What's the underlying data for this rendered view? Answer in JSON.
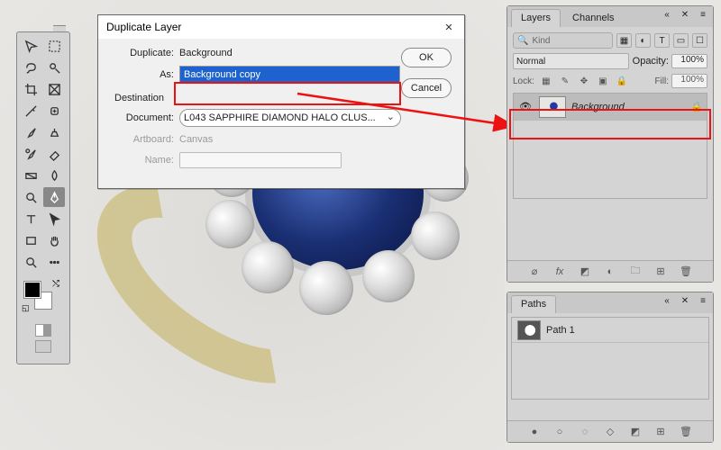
{
  "tools": [
    {
      "name": "move-tool"
    },
    {
      "name": "artboard-tool"
    },
    {
      "name": "marquee-tool"
    },
    {
      "name": "lasso-tool"
    },
    {
      "name": "crop-tool"
    },
    {
      "name": "frame-tool"
    },
    {
      "name": "eyedropper-tool"
    },
    {
      "name": "spot-heal-tool"
    },
    {
      "name": "brush-tool"
    },
    {
      "name": "clone-stamp-tool"
    },
    {
      "name": "history-brush-tool"
    },
    {
      "name": "eraser-tool"
    },
    {
      "name": "gradient-tool"
    },
    {
      "name": "blur-tool"
    },
    {
      "name": "dodge-tool"
    },
    {
      "name": "pen-tool",
      "selected": true
    },
    {
      "name": "type-tool"
    },
    {
      "name": "path-select-tool"
    },
    {
      "name": "rectangle-tool"
    },
    {
      "name": "hand-tool"
    },
    {
      "name": "zoom-tool"
    },
    {
      "name": "edit-toolbar"
    }
  ],
  "dialog": {
    "title": "Duplicate Layer",
    "duplicate_label": "Duplicate:",
    "duplicate_value": "Background",
    "as_label": "As:",
    "as_value": "Background copy",
    "destination_label": "Destination",
    "document_label": "Document:",
    "document_value": "L043 SAPPHIRE DIAMOND HALO CLUS...",
    "artboard_label": "Artboard:",
    "artboard_value": "Canvas",
    "name_label": "Name:",
    "ok_label": "OK",
    "cancel_label": "Cancel"
  },
  "layers_panel": {
    "tab_layers": "Layers",
    "tab_channels": "Channels",
    "kind_placeholder": "Kind",
    "blend_mode": "Normal",
    "opacity_label": "Opacity:",
    "opacity_value": "100%",
    "lock_label": "Lock:",
    "fill_label": "Fill:",
    "fill_value": "100%",
    "layer_name": "Background"
  },
  "paths_panel": {
    "tab_paths": "Paths",
    "path_name": "Path 1"
  }
}
